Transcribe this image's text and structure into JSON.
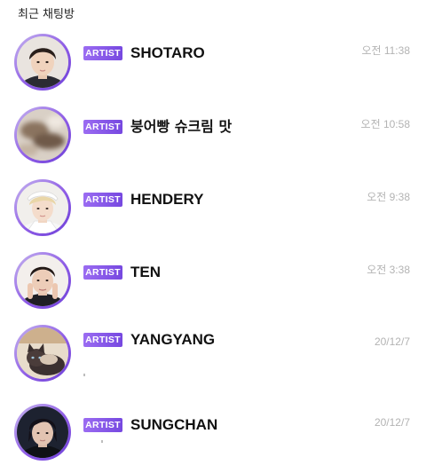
{
  "header": {
    "title": "최근 채팅방"
  },
  "chats": [
    {
      "badge": "ARTIST",
      "name": "SHOTARO",
      "time": "오전 11:38",
      "avatar": "avatar-shotaro"
    },
    {
      "badge": "ARTIST",
      "name": "붕어빵 슈크림 맛",
      "time": "오전 10:58",
      "avatar": "avatar-blurred-photo"
    },
    {
      "badge": "ARTIST",
      "name": "HENDERY",
      "time": "오전 9:38",
      "avatar": "avatar-hendery"
    },
    {
      "badge": "ARTIST",
      "name": "TEN",
      "time": "오전 3:38",
      "avatar": "avatar-ten"
    },
    {
      "badge": "ARTIST",
      "name": "YANGYANG",
      "time": "20/12/7",
      "avatar": "avatar-cat-photo"
    },
    {
      "badge": "ARTIST",
      "name": "SUNGCHAN",
      "time": "20/12/7",
      "avatar": "avatar-sungchan"
    }
  ],
  "colors": {
    "badge_start": "#9b6cf2",
    "badge_end": "#7648e0",
    "ring": "#8e5ce6",
    "time_text": "#b3b3b3"
  }
}
